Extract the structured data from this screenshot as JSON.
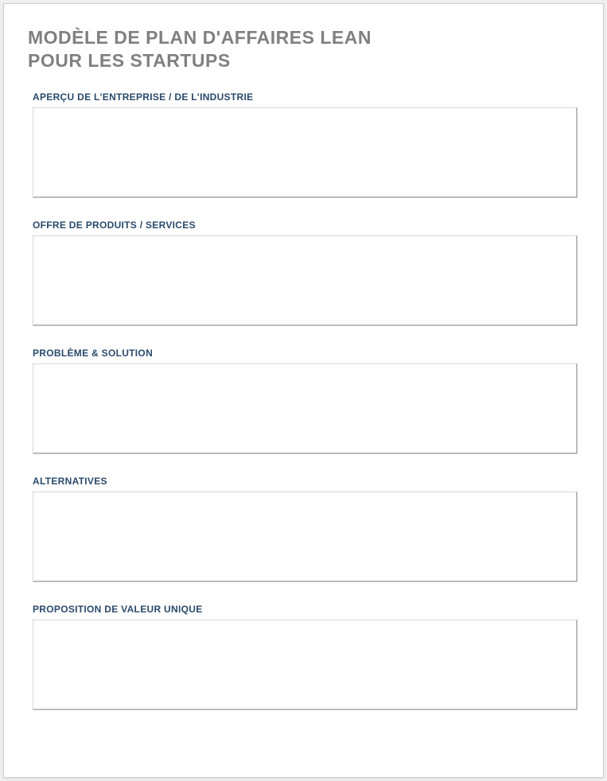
{
  "title_line1": "MODÈLE DE PLAN D'AFFAIRES LEAN",
  "title_line2": "POUR LES STARTUPS",
  "sections": [
    {
      "label": "APERÇU DE L'ENTREPRISE / DE L'INDUSTRIE",
      "value": ""
    },
    {
      "label": "OFFRE DE PRODUITS / SERVICES",
      "value": ""
    },
    {
      "label": "PROBLÈME & SOLUTION",
      "value": ""
    },
    {
      "label": "ALTERNATIVES",
      "value": ""
    },
    {
      "label": "PROPOSITION DE VALEUR UNIQUE",
      "value": ""
    }
  ]
}
